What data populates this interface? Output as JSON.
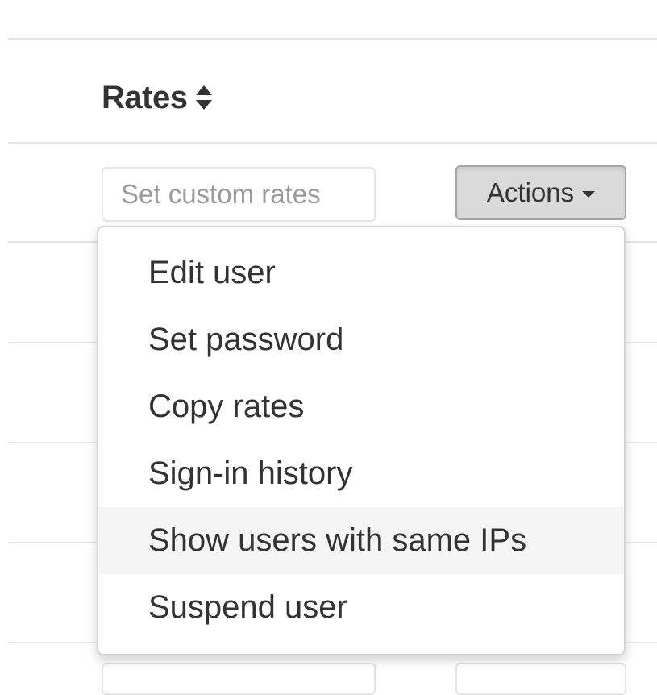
{
  "table_header": {
    "column_label": "Rates",
    "sort_icon": "sort-up-down-icon"
  },
  "row": {
    "rates_input": {
      "value": "",
      "placeholder": "Set custom rates"
    },
    "actions_button": {
      "label": "Actions",
      "icon": "caret-down-icon"
    }
  },
  "actions_menu": {
    "items": [
      {
        "label": "Edit user"
      },
      {
        "label": "Set password"
      },
      {
        "label": "Copy rates"
      },
      {
        "label": "Sign-in history"
      },
      {
        "label": "Show users with same IPs",
        "highlighted": true
      },
      {
        "label": "Suspend user"
      }
    ]
  },
  "colors": {
    "text": "#333333",
    "placeholder": "#9a9a9a",
    "divider": "#e4e4e4",
    "button_active_bg": "#dadada",
    "menu_hover_bg": "#f5f5f5"
  }
}
